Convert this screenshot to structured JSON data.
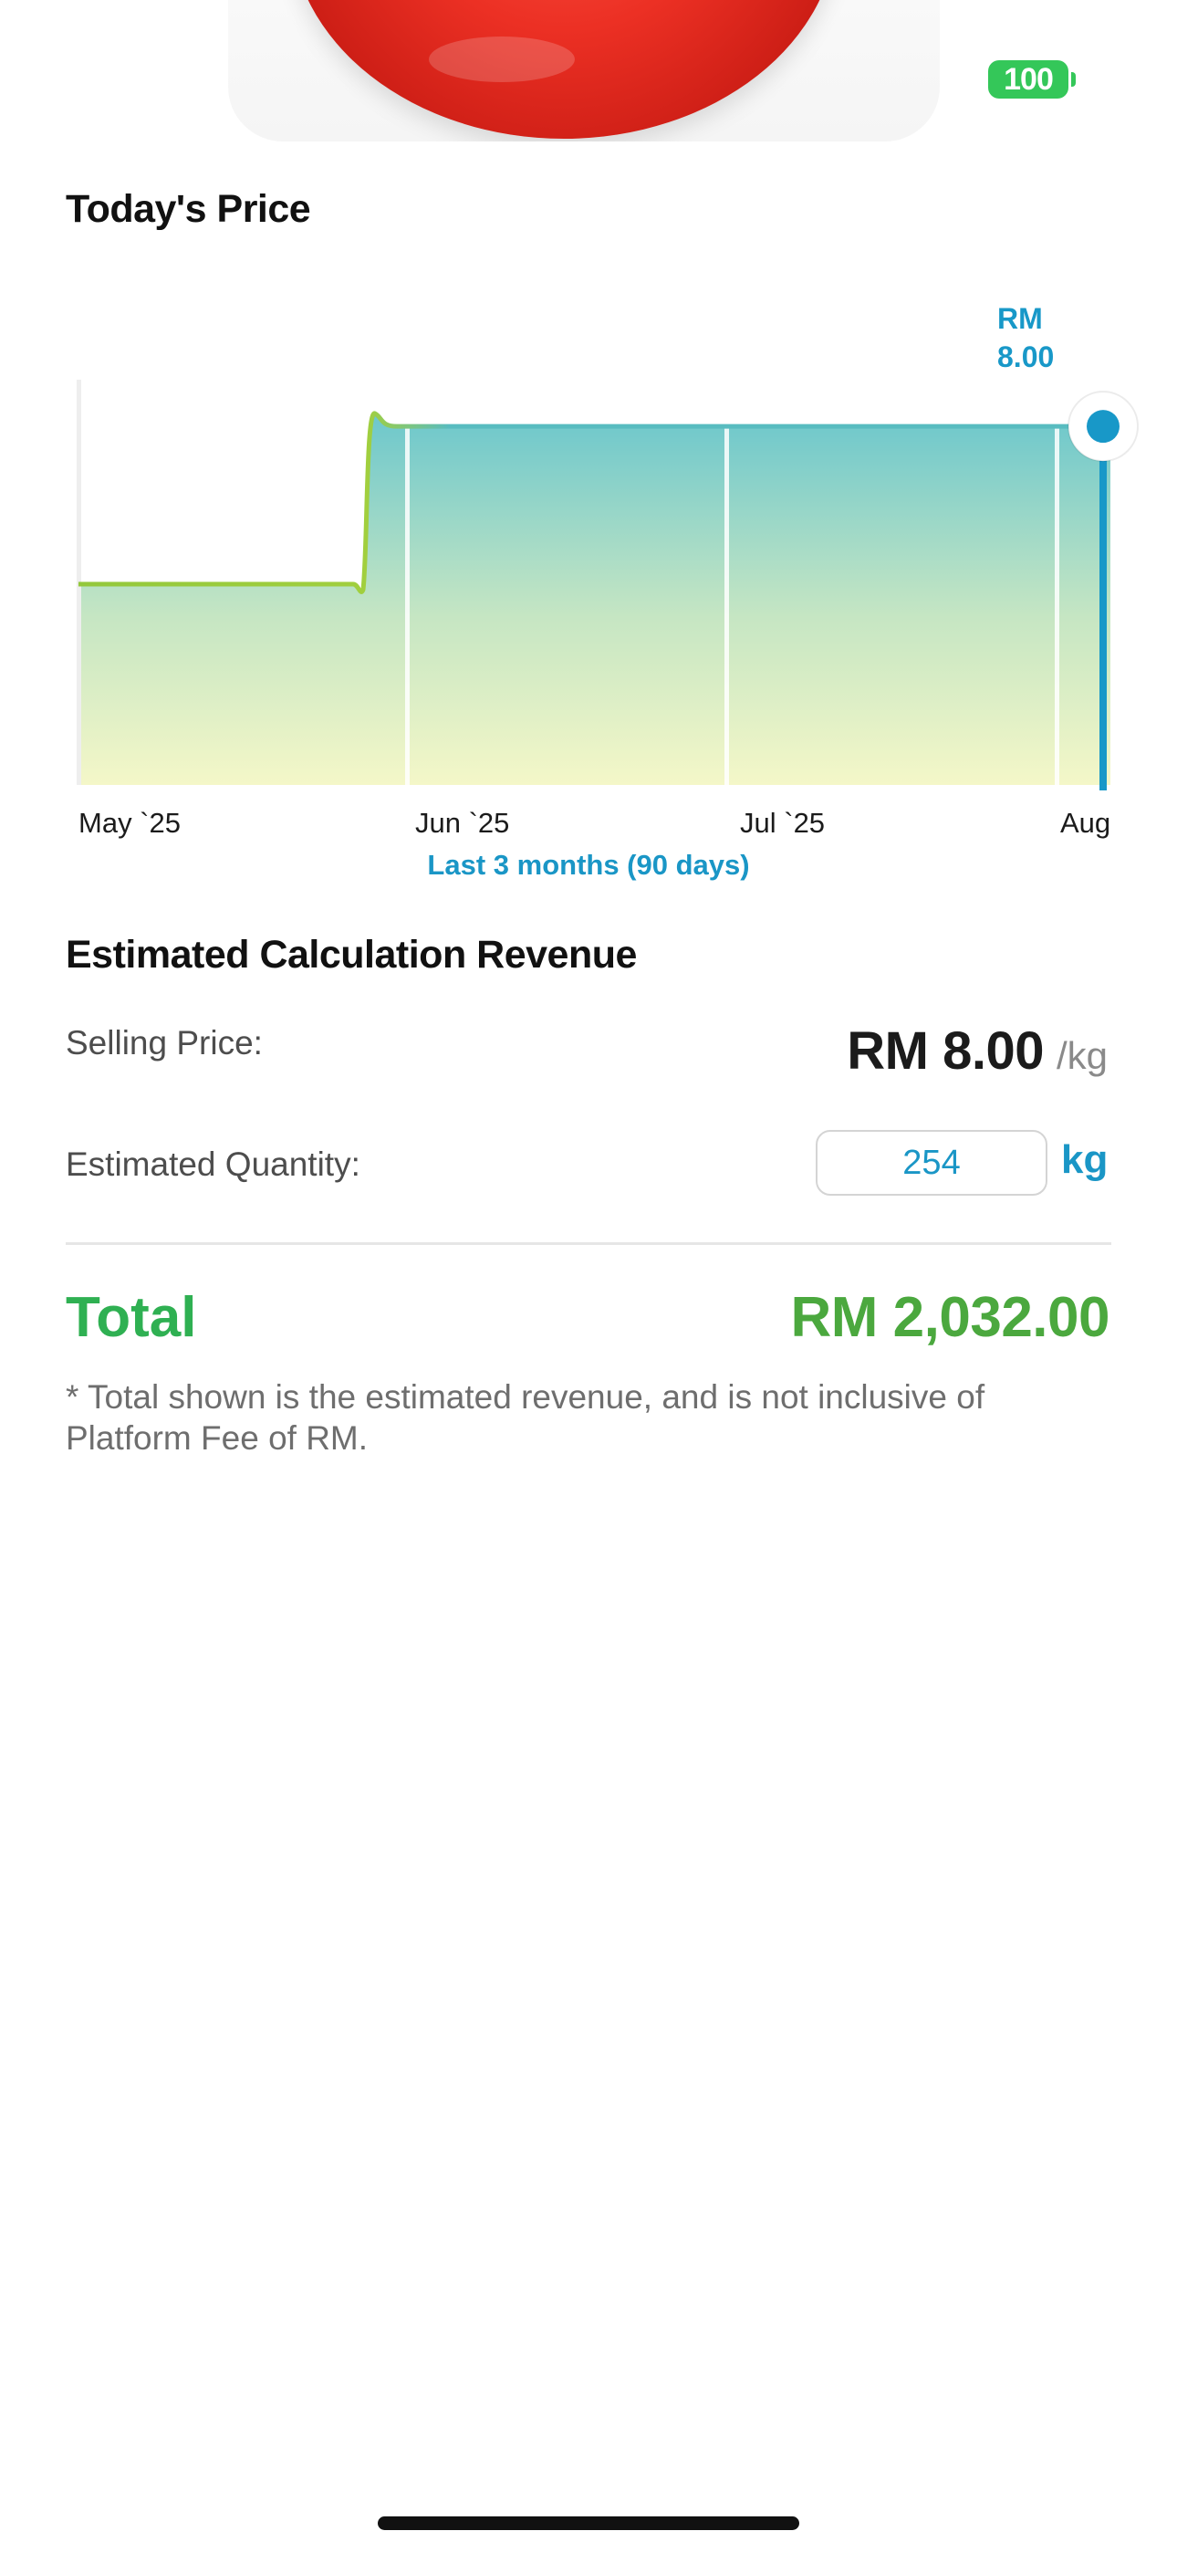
{
  "status_bar": {
    "battery_level": "100",
    "battery_color": "#34c759"
  },
  "hero": {
    "image": "tomato"
  },
  "price_section": {
    "title": "Today's Price",
    "tooltip_line1": "RM",
    "tooltip_line2": "8.00",
    "range_label": "Last 3 months (90 days)"
  },
  "chart_data": {
    "type": "area",
    "x_tick_labels": [
      "May `25",
      "Jun `25",
      "Jul `25",
      "Aug"
    ],
    "series": [
      {
        "points": [
          {
            "x": "May `25",
            "y": 6.9
          },
          {
            "x": "late May `25",
            "y": 6.9
          },
          {
            "x": "end May `25",
            "y": 8.0
          },
          {
            "x": "Jun `25",
            "y": 8.0
          },
          {
            "x": "Jul `25",
            "y": 8.0
          },
          {
            "x": "Aug",
            "y": 8.0
          }
        ]
      }
    ],
    "selected_value": 8.0,
    "colors": {
      "line_low": "#93c83c",
      "line_high": "#58bcc0",
      "fill_top": "#6cc7cc",
      "fill_bottom": "#f4f7c8",
      "cursor": "#1898c8"
    },
    "grid": "vertical"
  },
  "revenue": {
    "title": "Estimated Calculation Revenue",
    "selling_price_label": "Selling Price:",
    "selling_price_value": "RM 8.00",
    "selling_price_unit": "/kg",
    "quantity_label": "Estimated Quantity:",
    "quantity_value": "254",
    "quantity_unit": "kg",
    "total_label": "Total",
    "total_value": "RM 2,032.00",
    "note": "* Total shown is the estimated revenue, and is not inclusive of Platform Fee of RM."
  }
}
